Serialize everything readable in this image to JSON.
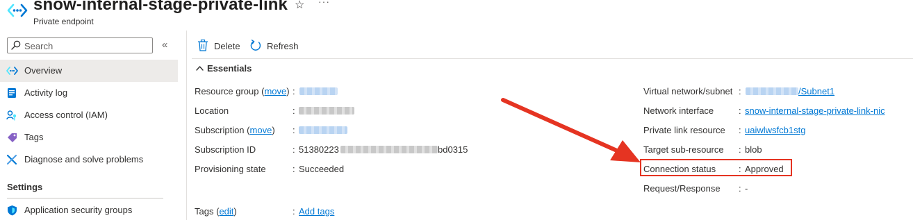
{
  "header": {
    "title": "snow-internal-stage-private-link",
    "subtitle": "Private endpoint",
    "favorite_icon": "star-outline-icon",
    "more_icon": "ellipsis-icon",
    "more_label": "···",
    "resource_icon": "private-endpoint-icon"
  },
  "sidebar": {
    "search_placeholder": "Search",
    "collapse_glyph": "«",
    "items": [
      {
        "label": "Overview",
        "icon": "overview-icon",
        "active": true
      },
      {
        "label": "Activity log",
        "icon": "activity-log-icon"
      },
      {
        "label": "Access control (IAM)",
        "icon": "iam-icon"
      },
      {
        "label": "Tags",
        "icon": "tag-icon"
      },
      {
        "label": "Diagnose and solve problems",
        "icon": "wrench-icon"
      }
    ],
    "settings_heading": "Settings",
    "settings_items": [
      {
        "label": "Application security groups",
        "icon": "shield-icon"
      }
    ]
  },
  "toolbar": {
    "delete_label": "Delete",
    "refresh_label": "Refresh"
  },
  "essentials": {
    "heading": "Essentials",
    "left": [
      {
        "label": "Resource group",
        "link": "move",
        "value": ""
      },
      {
        "label": "Location",
        "value": ""
      },
      {
        "label": "Subscription",
        "link": "move",
        "value": ""
      },
      {
        "label": "Subscription ID",
        "value_prefix": "51380223",
        "value_suffix": "bd0315"
      },
      {
        "label": "Provisioning state",
        "value": "Succeeded"
      }
    ],
    "right": [
      {
        "label": "Virtual network/subnet",
        "value": "/Subnet1"
      },
      {
        "label": "Network interface",
        "value": "snow-internal-stage-private-link-nic"
      },
      {
        "label": "Private link resource",
        "value": "uaiwlwsfcb1stg"
      },
      {
        "label": "Target sub-resource",
        "value": "blob"
      },
      {
        "label": "Connection status",
        "value": "Approved"
      },
      {
        "label": "Request/Response",
        "value": "-"
      }
    ],
    "tags": {
      "label": "Tags",
      "link": "edit",
      "value": "Add tags"
    },
    "separator": ":",
    "open_paren": "(",
    "close_paren": ")"
  },
  "annotation": {
    "color": "#e53422"
  },
  "colors": {
    "link": "#0078d4",
    "accent": "#0078d4"
  }
}
